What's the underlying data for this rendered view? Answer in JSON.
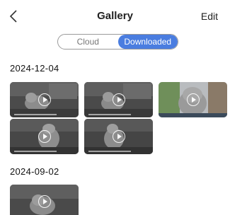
{
  "header": {
    "title": "Gallery",
    "edit_label": "Edit",
    "back_icon": "chevron-left-icon"
  },
  "tabs": [
    {
      "label": "Cloud",
      "active": false
    },
    {
      "label": "Downloaded",
      "active": true
    }
  ],
  "accent_color": "#4a7de0",
  "groups": [
    {
      "date": "2024-12-04",
      "thumbnail_count": 5
    },
    {
      "date": "2024-09-02",
      "thumbnail_count": 1
    }
  ],
  "thumbnail_icon": "play-circle-icon"
}
